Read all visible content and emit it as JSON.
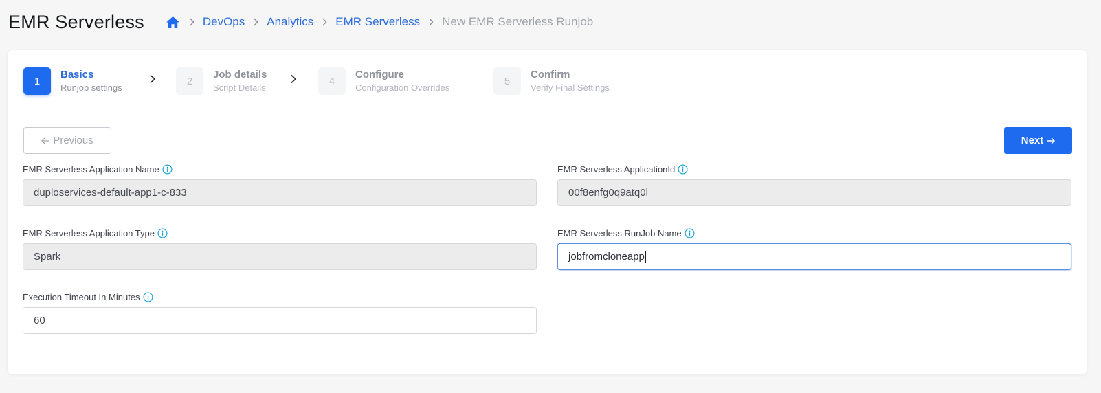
{
  "header": {
    "title": "EMR Serverless",
    "home_icon": "home-icon",
    "breadcrumb": [
      "DevOps",
      "Analytics",
      "EMR Serverless"
    ],
    "current": "New EMR Serverless Runjob"
  },
  "steps": [
    {
      "num": "1",
      "title": "Basics",
      "subtitle": "Runjob settings",
      "active": true
    },
    {
      "num": "2",
      "title": "Job details",
      "subtitle": "Script Details",
      "active": false
    },
    {
      "num": "4",
      "title": "Configure",
      "subtitle": "Configuration Overrides",
      "active": false
    },
    {
      "num": "5",
      "title": "Confirm",
      "subtitle": "Verify Final Settings",
      "active": false
    }
  ],
  "buttons": {
    "previous": "Previous",
    "next": "Next"
  },
  "fields": {
    "app_name": {
      "label": "EMR Serverless Application Name",
      "value": "duploservices-default-app1-c-833"
    },
    "app_id": {
      "label": "EMR Serverless ApplicationId",
      "value": "00f8enfg0q9atq0l"
    },
    "app_type": {
      "label": "EMR Serverless Application Type",
      "value": "Spark"
    },
    "runjob_name": {
      "label": "EMR Serverless RunJob Name",
      "value": "jobfromcloneapp"
    },
    "timeout": {
      "label": "Execution Timeout In Minutes",
      "value": "60"
    }
  },
  "colors": {
    "accent": "#1e6bf0",
    "link": "#2f6ed8",
    "info": "#1ba4d6"
  }
}
